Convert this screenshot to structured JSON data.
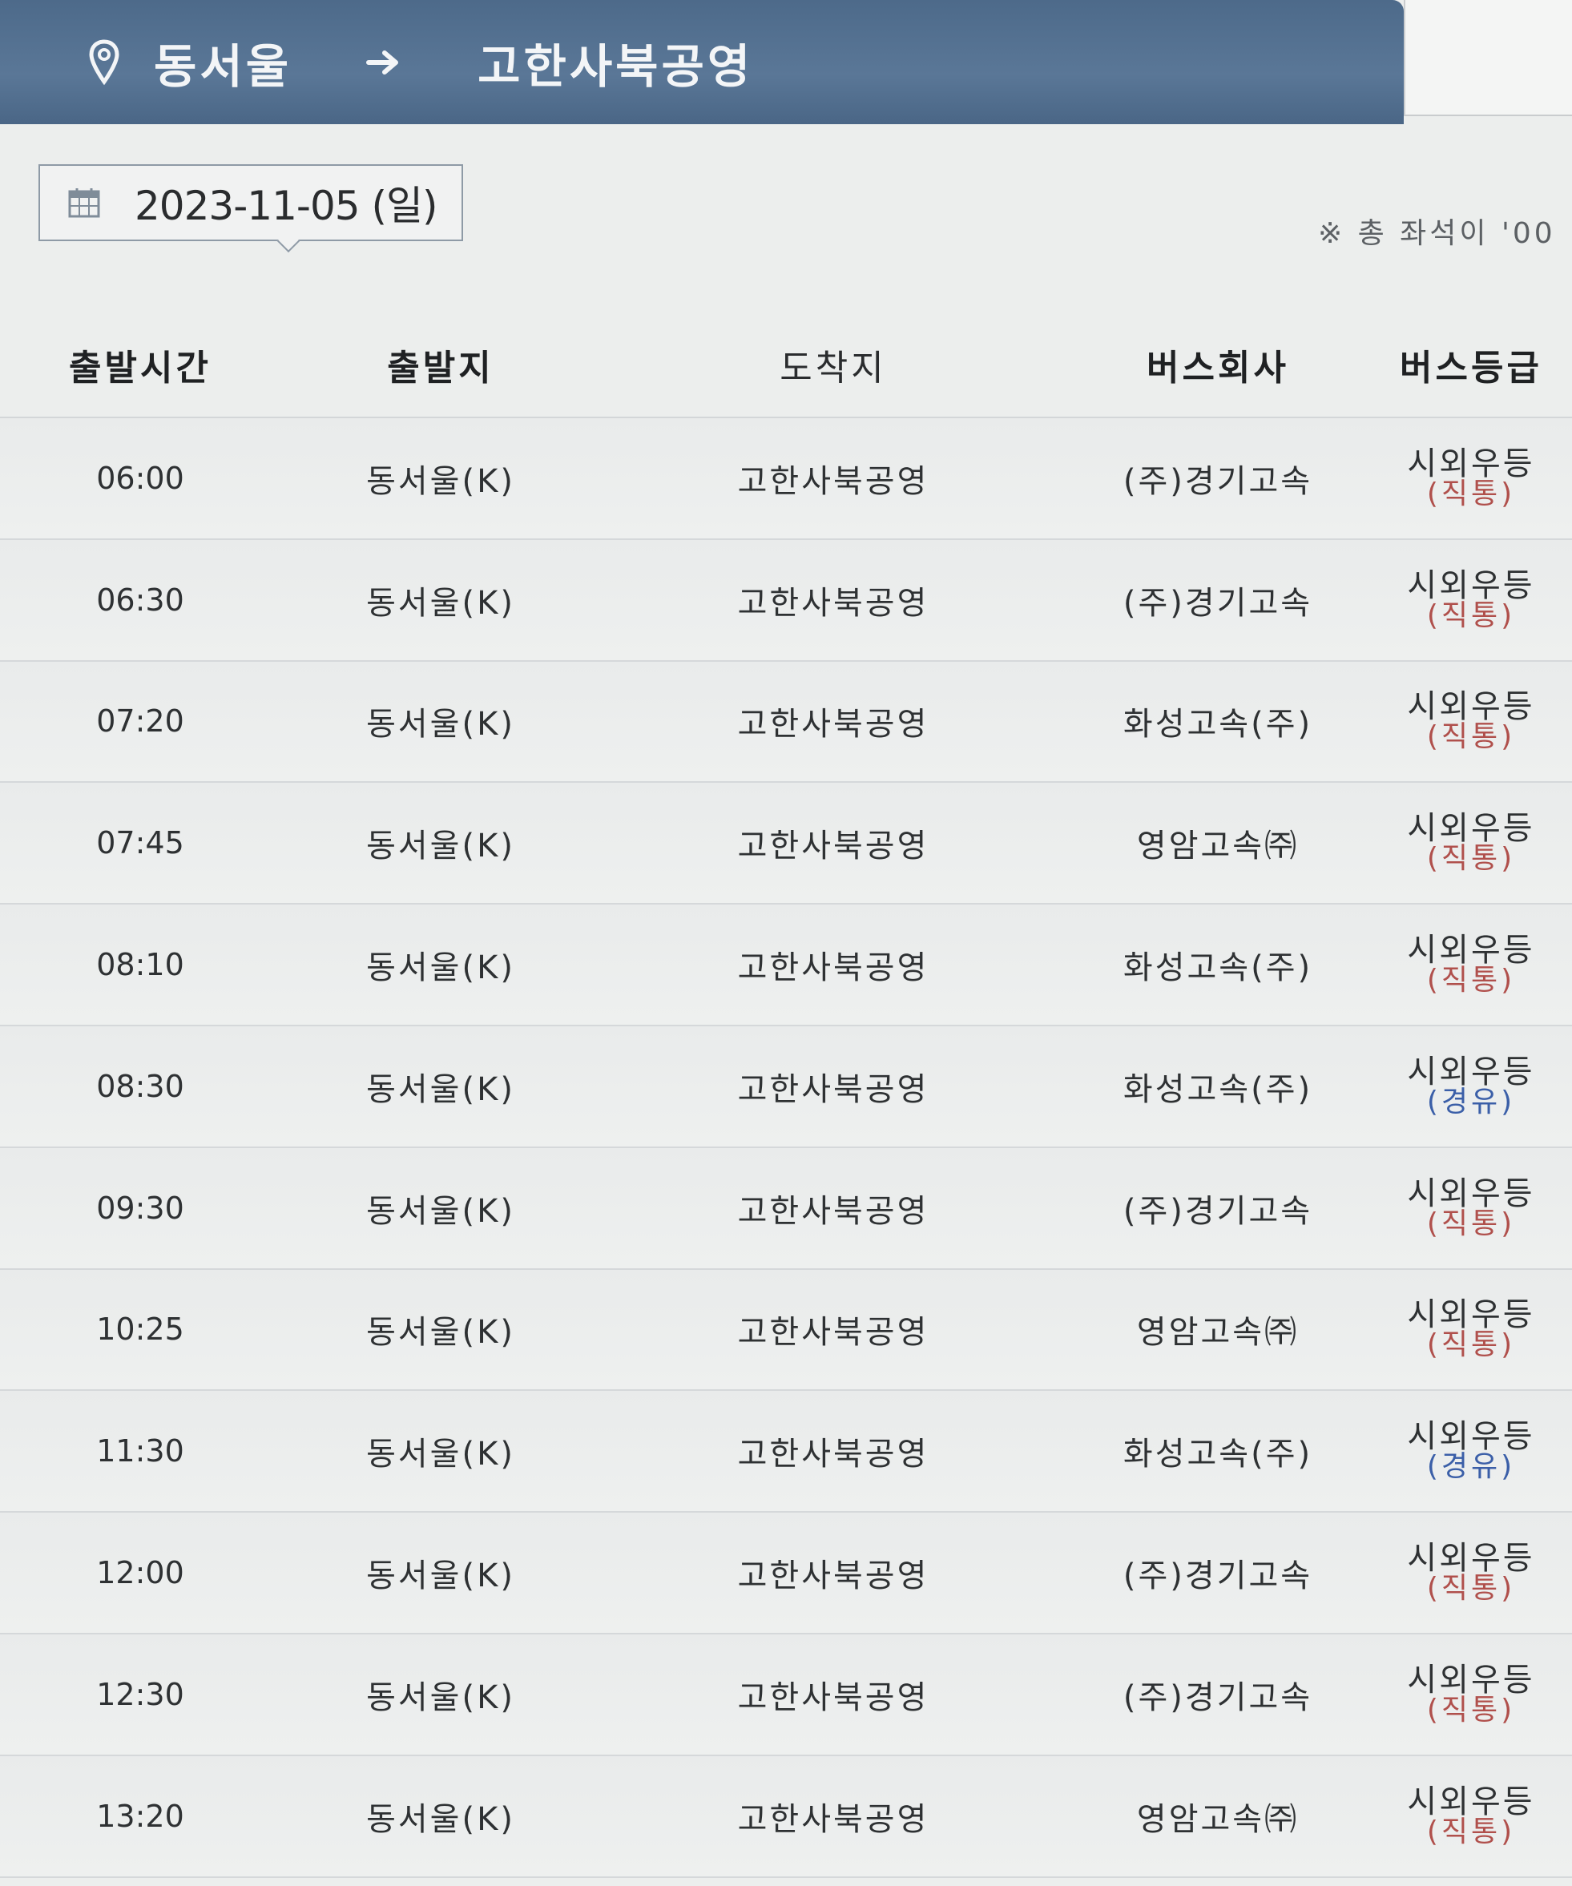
{
  "header": {
    "origin": "동서울",
    "destination": "고한사북공영"
  },
  "date": "2023-11-05 (일)",
  "notice": "※ 총 좌석이 '00",
  "columns": [
    "출발시간",
    "출발지",
    "도착지",
    "버스회사",
    "버스등급"
  ],
  "rows": [
    {
      "time": "06:00",
      "origin": "동서울(K)",
      "destination": "고한사북공영",
      "company": "(주)경기고속",
      "grade": "시외우등",
      "route_type": "(직통)"
    },
    {
      "time": "06:30",
      "origin": "동서울(K)",
      "destination": "고한사북공영",
      "company": "(주)경기고속",
      "grade": "시외우등",
      "route_type": "(직통)"
    },
    {
      "time": "07:20",
      "origin": "동서울(K)",
      "destination": "고한사북공영",
      "company": "화성고속(주)",
      "grade": "시외우등",
      "route_type": "(직통)"
    },
    {
      "time": "07:45",
      "origin": "동서울(K)",
      "destination": "고한사북공영",
      "company": "영암고속㈜",
      "grade": "시외우등",
      "route_type": "(직통)"
    },
    {
      "time": "08:10",
      "origin": "동서울(K)",
      "destination": "고한사북공영",
      "company": "화성고속(주)",
      "grade": "시외우등",
      "route_type": "(직통)"
    },
    {
      "time": "08:30",
      "origin": "동서울(K)",
      "destination": "고한사북공영",
      "company": "화성고속(주)",
      "grade": "시외우등",
      "route_type": "(경유)"
    },
    {
      "time": "09:30",
      "origin": "동서울(K)",
      "destination": "고한사북공영",
      "company": "(주)경기고속",
      "grade": "시외우등",
      "route_type": "(직통)"
    },
    {
      "time": "10:25",
      "origin": "동서울(K)",
      "destination": "고한사북공영",
      "company": "영암고속㈜",
      "grade": "시외우등",
      "route_type": "(직통)"
    },
    {
      "time": "11:30",
      "origin": "동서울(K)",
      "destination": "고한사북공영",
      "company": "화성고속(주)",
      "grade": "시외우등",
      "route_type": "(경유)"
    },
    {
      "time": "12:00",
      "origin": "동서울(K)",
      "destination": "고한사북공영",
      "company": "(주)경기고속",
      "grade": "시외우등",
      "route_type": "(직통)"
    },
    {
      "time": "12:30",
      "origin": "동서울(K)",
      "destination": "고한사북공영",
      "company": "(주)경기고속",
      "grade": "시외우등",
      "route_type": "(직통)"
    },
    {
      "time": "13:20",
      "origin": "동서울(K)",
      "destination": "고한사북공영",
      "company": "영암고속㈜",
      "grade": "시외우등",
      "route_type": "(직통)"
    }
  ],
  "icons": {
    "pin": "location-pin-icon",
    "arrow": "arrow-right-icon",
    "calendar": "calendar-icon"
  },
  "colors": {
    "header_bg": "#51708f",
    "direct": "#b0504c",
    "via": "#3b5fa8"
  }
}
